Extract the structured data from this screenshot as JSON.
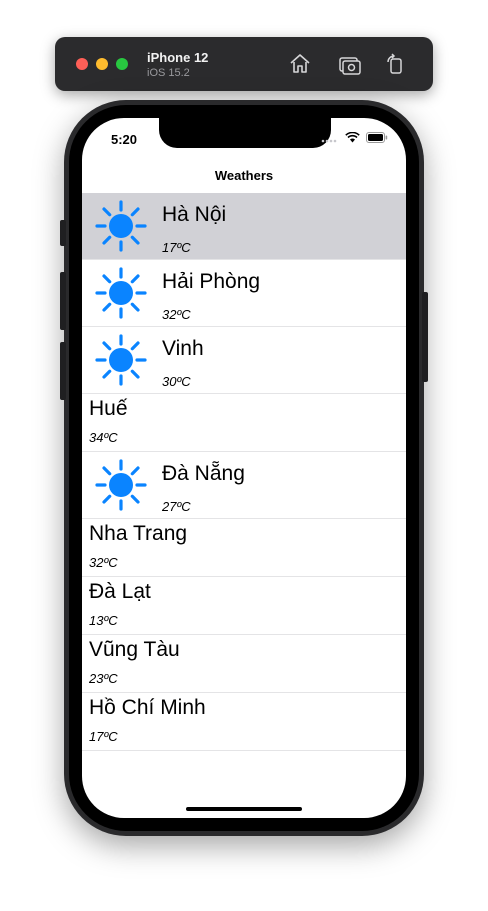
{
  "simulator": {
    "device_name": "iPhone 12",
    "os_version": "iOS 15.2"
  },
  "status_bar": {
    "time": "5:20"
  },
  "nav": {
    "title": "Weathers"
  },
  "colors": {
    "accent": "#0a84ff",
    "selected_row": "#d1d1d6"
  },
  "cities": [
    {
      "name": "Hà Nội",
      "temp": "17ºC",
      "icon": "sun-icon",
      "selected": true
    },
    {
      "name": "Hải Phòng",
      "temp": "32ºC",
      "icon": "sun-icon",
      "selected": false
    },
    {
      "name": "Vinh",
      "temp": "30ºC",
      "icon": "sun-icon",
      "selected": false
    },
    {
      "name": "Huế",
      "temp": "34ºC",
      "icon": null,
      "selected": false
    },
    {
      "name": "Đà Nẵng",
      "temp": "27ºC",
      "icon": "sun-icon",
      "selected": false
    },
    {
      "name": "Nha Trang",
      "temp": "32ºC",
      "icon": null,
      "selected": false
    },
    {
      "name": "Đà Lạt",
      "temp": "13ºC",
      "icon": null,
      "selected": false
    },
    {
      "name": "Vũng Tàu",
      "temp": "23ºC",
      "icon": null,
      "selected": false
    },
    {
      "name": "Hồ Chí Minh",
      "temp": "17ºC",
      "icon": null,
      "selected": false
    }
  ]
}
